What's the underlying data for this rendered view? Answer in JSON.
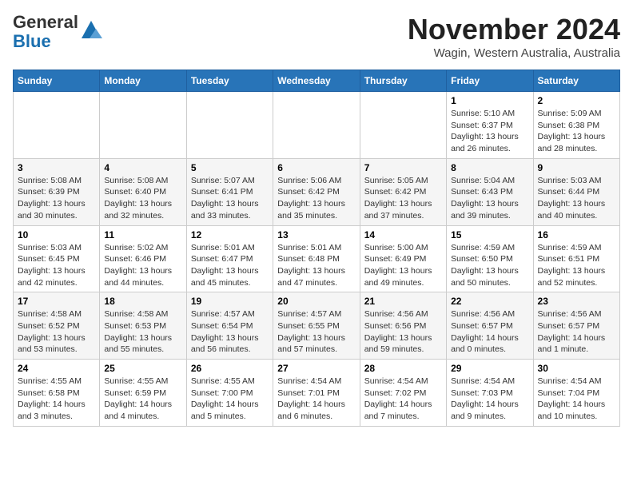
{
  "header": {
    "logo_line1": "General",
    "logo_line2": "Blue",
    "month": "November 2024",
    "location": "Wagin, Western Australia, Australia"
  },
  "days_of_week": [
    "Sunday",
    "Monday",
    "Tuesday",
    "Wednesday",
    "Thursday",
    "Friday",
    "Saturday"
  ],
  "weeks": [
    [
      {
        "day": "",
        "info": ""
      },
      {
        "day": "",
        "info": ""
      },
      {
        "day": "",
        "info": ""
      },
      {
        "day": "",
        "info": ""
      },
      {
        "day": "",
        "info": ""
      },
      {
        "day": "1",
        "info": "Sunrise: 5:10 AM\nSunset: 6:37 PM\nDaylight: 13 hours\nand 26 minutes."
      },
      {
        "day": "2",
        "info": "Sunrise: 5:09 AM\nSunset: 6:38 PM\nDaylight: 13 hours\nand 28 minutes."
      }
    ],
    [
      {
        "day": "3",
        "info": "Sunrise: 5:08 AM\nSunset: 6:39 PM\nDaylight: 13 hours\nand 30 minutes."
      },
      {
        "day": "4",
        "info": "Sunrise: 5:08 AM\nSunset: 6:40 PM\nDaylight: 13 hours\nand 32 minutes."
      },
      {
        "day": "5",
        "info": "Sunrise: 5:07 AM\nSunset: 6:41 PM\nDaylight: 13 hours\nand 33 minutes."
      },
      {
        "day": "6",
        "info": "Sunrise: 5:06 AM\nSunset: 6:42 PM\nDaylight: 13 hours\nand 35 minutes."
      },
      {
        "day": "7",
        "info": "Sunrise: 5:05 AM\nSunset: 6:42 PM\nDaylight: 13 hours\nand 37 minutes."
      },
      {
        "day": "8",
        "info": "Sunrise: 5:04 AM\nSunset: 6:43 PM\nDaylight: 13 hours\nand 39 minutes."
      },
      {
        "day": "9",
        "info": "Sunrise: 5:03 AM\nSunset: 6:44 PM\nDaylight: 13 hours\nand 40 minutes."
      }
    ],
    [
      {
        "day": "10",
        "info": "Sunrise: 5:03 AM\nSunset: 6:45 PM\nDaylight: 13 hours\nand 42 minutes."
      },
      {
        "day": "11",
        "info": "Sunrise: 5:02 AM\nSunset: 6:46 PM\nDaylight: 13 hours\nand 44 minutes."
      },
      {
        "day": "12",
        "info": "Sunrise: 5:01 AM\nSunset: 6:47 PM\nDaylight: 13 hours\nand 45 minutes."
      },
      {
        "day": "13",
        "info": "Sunrise: 5:01 AM\nSunset: 6:48 PM\nDaylight: 13 hours\nand 47 minutes."
      },
      {
        "day": "14",
        "info": "Sunrise: 5:00 AM\nSunset: 6:49 PM\nDaylight: 13 hours\nand 49 minutes."
      },
      {
        "day": "15",
        "info": "Sunrise: 4:59 AM\nSunset: 6:50 PM\nDaylight: 13 hours\nand 50 minutes."
      },
      {
        "day": "16",
        "info": "Sunrise: 4:59 AM\nSunset: 6:51 PM\nDaylight: 13 hours\nand 52 minutes."
      }
    ],
    [
      {
        "day": "17",
        "info": "Sunrise: 4:58 AM\nSunset: 6:52 PM\nDaylight: 13 hours\nand 53 minutes."
      },
      {
        "day": "18",
        "info": "Sunrise: 4:58 AM\nSunset: 6:53 PM\nDaylight: 13 hours\nand 55 minutes."
      },
      {
        "day": "19",
        "info": "Sunrise: 4:57 AM\nSunset: 6:54 PM\nDaylight: 13 hours\nand 56 minutes."
      },
      {
        "day": "20",
        "info": "Sunrise: 4:57 AM\nSunset: 6:55 PM\nDaylight: 13 hours\nand 57 minutes."
      },
      {
        "day": "21",
        "info": "Sunrise: 4:56 AM\nSunset: 6:56 PM\nDaylight: 13 hours\nand 59 minutes."
      },
      {
        "day": "22",
        "info": "Sunrise: 4:56 AM\nSunset: 6:57 PM\nDaylight: 14 hours\nand 0 minutes."
      },
      {
        "day": "23",
        "info": "Sunrise: 4:56 AM\nSunset: 6:57 PM\nDaylight: 14 hours\nand 1 minute."
      }
    ],
    [
      {
        "day": "24",
        "info": "Sunrise: 4:55 AM\nSunset: 6:58 PM\nDaylight: 14 hours\nand 3 minutes."
      },
      {
        "day": "25",
        "info": "Sunrise: 4:55 AM\nSunset: 6:59 PM\nDaylight: 14 hours\nand 4 minutes."
      },
      {
        "day": "26",
        "info": "Sunrise: 4:55 AM\nSunset: 7:00 PM\nDaylight: 14 hours\nand 5 minutes."
      },
      {
        "day": "27",
        "info": "Sunrise: 4:54 AM\nSunset: 7:01 PM\nDaylight: 14 hours\nand 6 minutes."
      },
      {
        "day": "28",
        "info": "Sunrise: 4:54 AM\nSunset: 7:02 PM\nDaylight: 14 hours\nand 7 minutes."
      },
      {
        "day": "29",
        "info": "Sunrise: 4:54 AM\nSunset: 7:03 PM\nDaylight: 14 hours\nand 9 minutes."
      },
      {
        "day": "30",
        "info": "Sunrise: 4:54 AM\nSunset: 7:04 PM\nDaylight: 14 hours\nand 10 minutes."
      }
    ]
  ]
}
